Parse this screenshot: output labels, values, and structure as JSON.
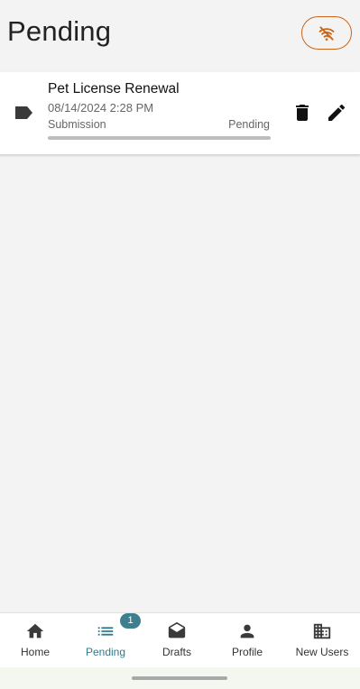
{
  "header": {
    "title": "Pending",
    "offline_icon": "wifi-off-icon",
    "offline_color": "#c8651b"
  },
  "pending_items": [
    {
      "title": "Pet License Renewal",
      "date": "08/14/2024 2:28 PM",
      "type": "Submission",
      "status": "Pending",
      "progress": 1.0,
      "icons": [
        "tag-icon",
        "delete-icon",
        "edit-icon"
      ]
    }
  ],
  "bottom_nav": {
    "active_color": "#2e7b8c",
    "items": [
      {
        "label": "Home",
        "icon": "home-icon"
      },
      {
        "label": "Pending",
        "icon": "list-icon",
        "badge": "1"
      },
      {
        "label": "Drafts",
        "icon": "drafts-icon"
      },
      {
        "label": "Profile",
        "icon": "person-icon"
      },
      {
        "label": "New Users",
        "icon": "building-icon"
      }
    ]
  }
}
